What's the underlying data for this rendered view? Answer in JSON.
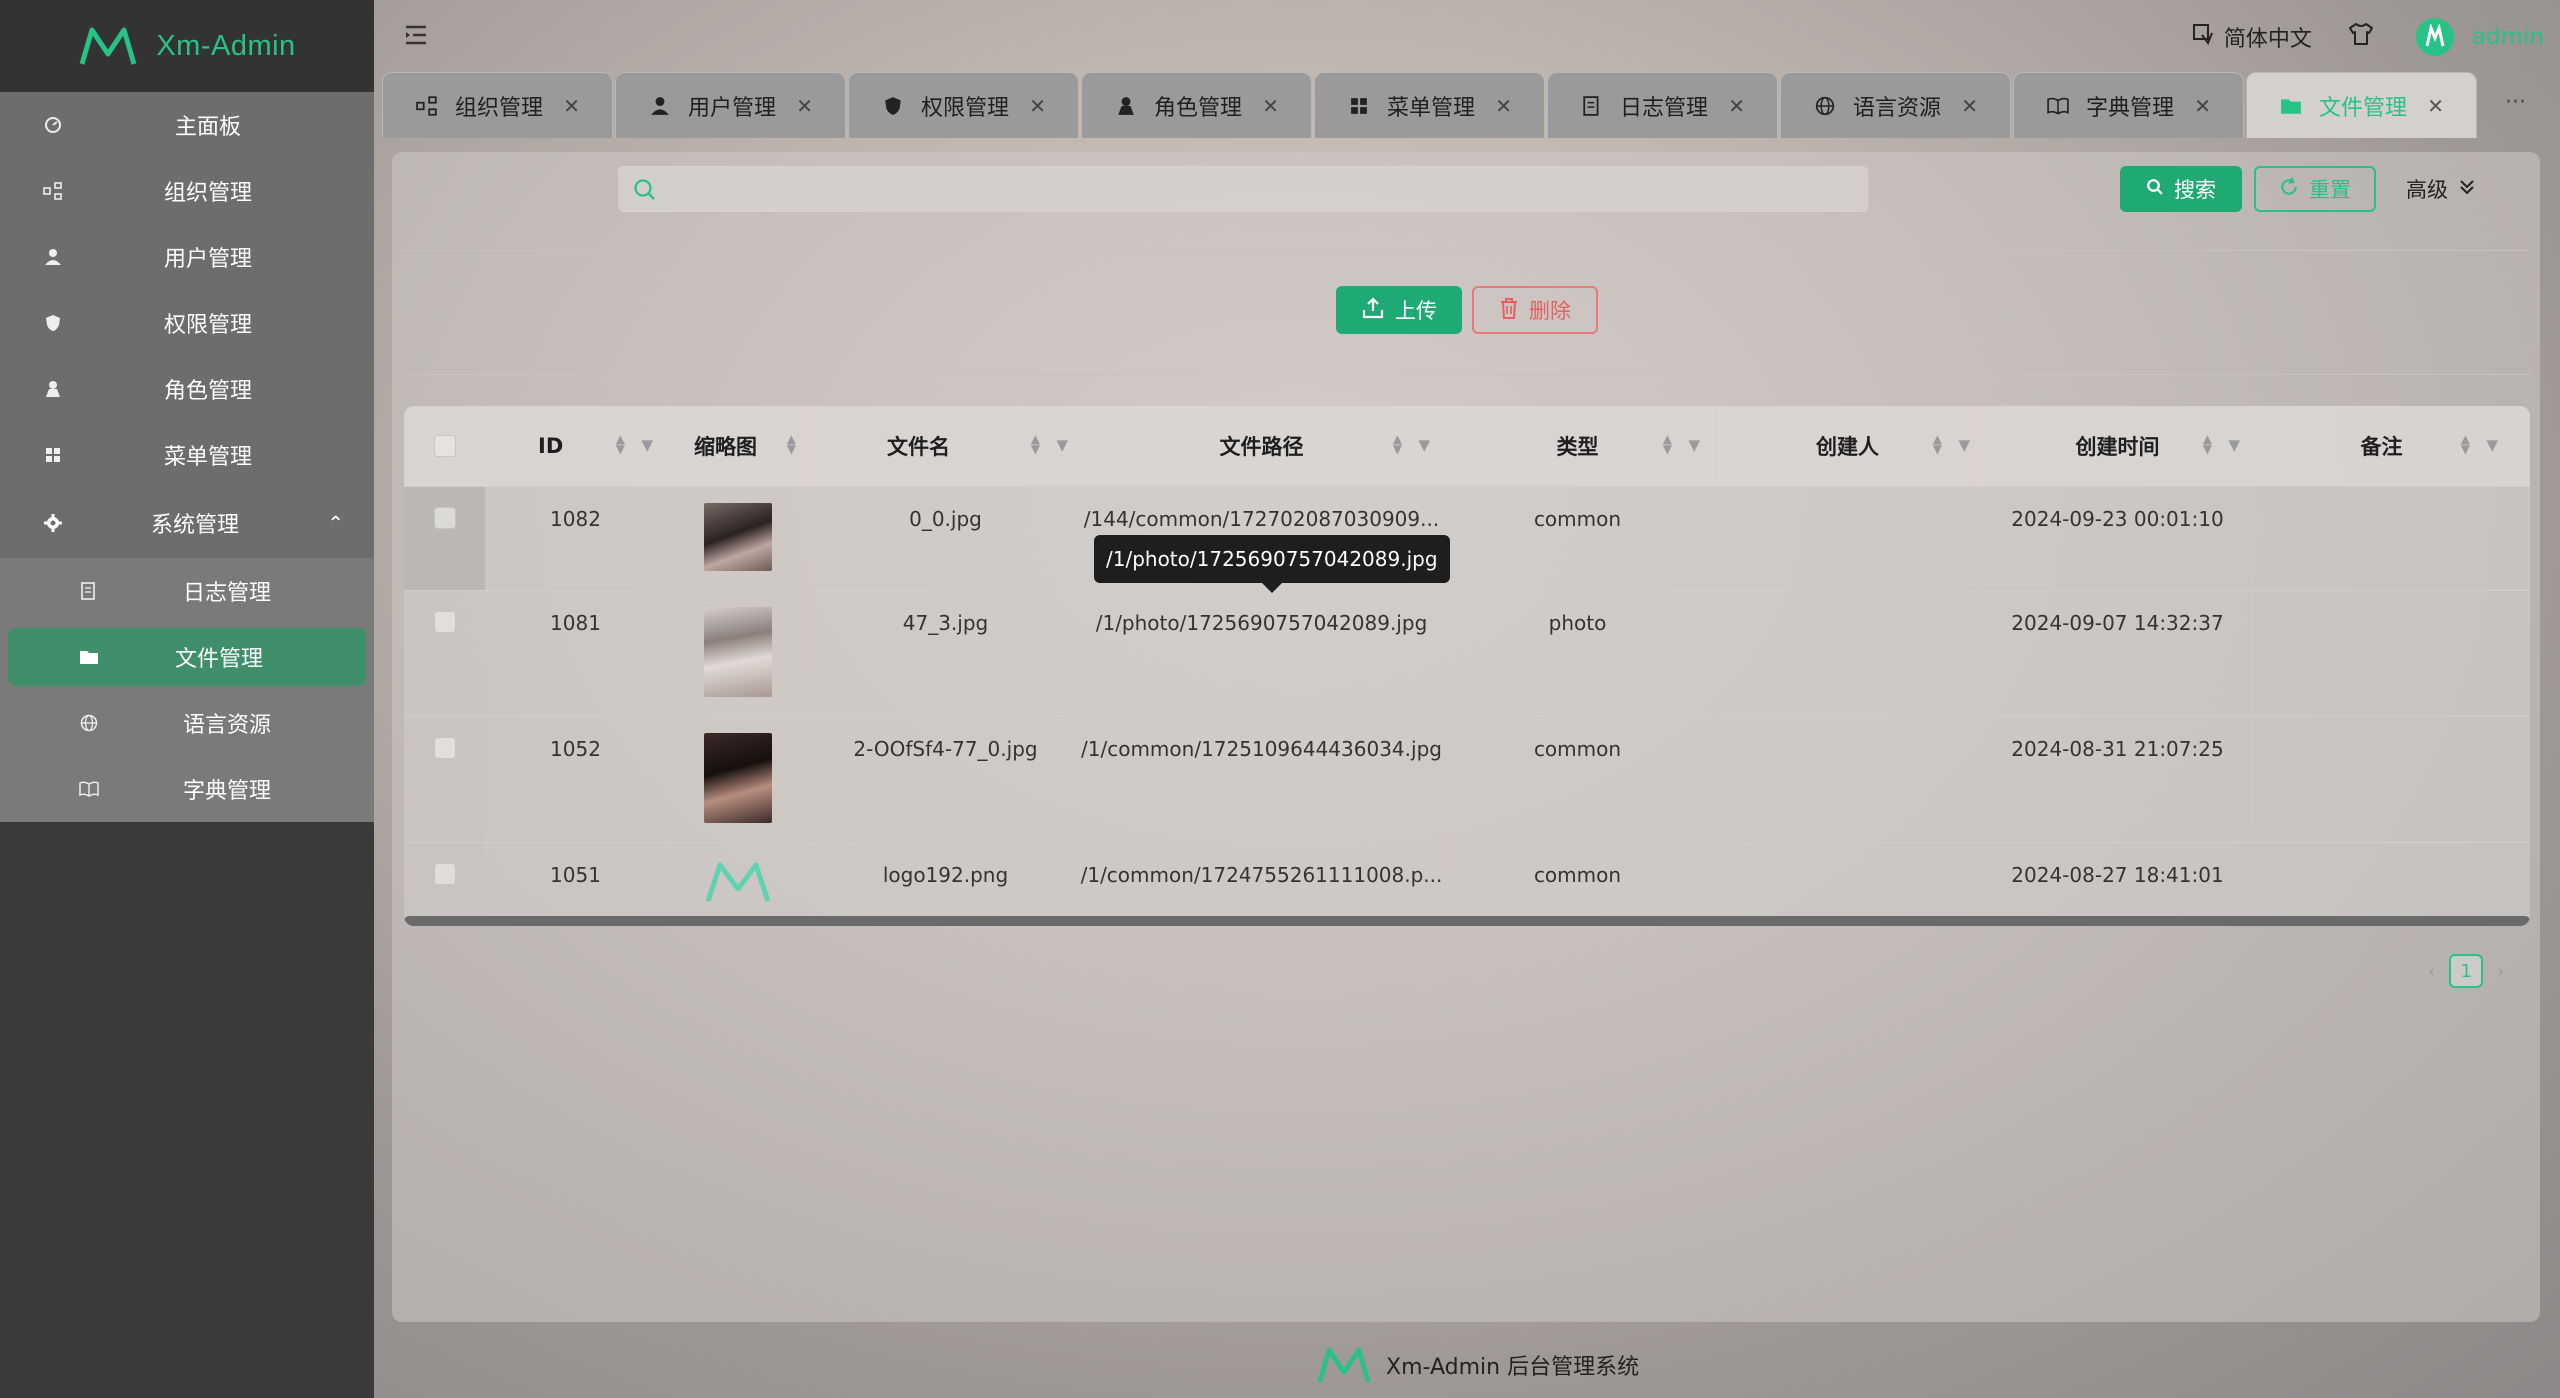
{
  "app": {
    "logo_text": "Xm-Admin",
    "footer_text": "Xm-Admin 后台管理系统",
    "brand_color": "#27c285"
  },
  "sidebar": {
    "items": [
      {
        "label": "主面板",
        "icon": "dashboard-icon"
      },
      {
        "label": "组织管理",
        "icon": "org-icon"
      },
      {
        "label": "用户管理",
        "icon": "user-icon"
      },
      {
        "label": "权限管理",
        "icon": "shield-icon"
      },
      {
        "label": "角色管理",
        "icon": "role-icon"
      },
      {
        "label": "菜单管理",
        "icon": "grid-icon"
      }
    ],
    "group": {
      "label": "系统管理",
      "icon": "gear-icon"
    },
    "sub_items": [
      {
        "label": "日志管理",
        "icon": "log-icon"
      },
      {
        "label": "文件管理",
        "icon": "folder-icon",
        "active": true
      },
      {
        "label": "语言资源",
        "icon": "globe-icon"
      },
      {
        "label": "字典管理",
        "icon": "book-icon"
      }
    ]
  },
  "topbar": {
    "language": "简体中文",
    "username": "admin"
  },
  "tabs": [
    {
      "label": "组织管理"
    },
    {
      "label": "用户管理"
    },
    {
      "label": "权限管理"
    },
    {
      "label": "角色管理"
    },
    {
      "label": "菜单管理"
    },
    {
      "label": "日志管理"
    },
    {
      "label": "语言资源"
    },
    {
      "label": "字典管理"
    },
    {
      "label": "文件管理",
      "active": true
    }
  ],
  "tabs_more": "···",
  "search": {
    "placeholder": "",
    "search_label": "搜索",
    "reset_label": "重置",
    "advanced_label": "高级"
  },
  "toolbar": {
    "upload_label": "上传",
    "delete_label": "删除"
  },
  "table": {
    "columns": [
      "ID",
      "缩略图",
      "文件名",
      "文件路径",
      "类型",
      "创建人",
      "创建时间",
      "备注"
    ],
    "rows": [
      {
        "id": "1082",
        "name": "0_0.jpg",
        "path": "/144/common/172702087030909...",
        "type": "common",
        "creator": "",
        "created": "2024-09-23 00:01:10",
        "note": ""
      },
      {
        "id": "1081",
        "name": "47_3.jpg",
        "path": "/1/photo/1725690757042089.jpg",
        "type": "photo",
        "creator": "",
        "created": "2024-09-07 14:32:37",
        "note": ""
      },
      {
        "id": "1052",
        "name": "2-OOfSf4-77_0.jpg",
        "path": "/1/common/1725109644436034.jpg",
        "type": "common",
        "creator": "",
        "created": "2024-08-31 21:07:25",
        "note": ""
      },
      {
        "id": "1051",
        "name": "logo192.png",
        "path": "/1/common/1724755261111008.p...",
        "type": "common",
        "creator": "",
        "created": "2024-08-27 18:41:01",
        "note": ""
      }
    ]
  },
  "tooltip": "/1/photo/1725690757042089.jpg",
  "pagination": {
    "current": "1",
    "prev": "‹",
    "next": "›"
  }
}
